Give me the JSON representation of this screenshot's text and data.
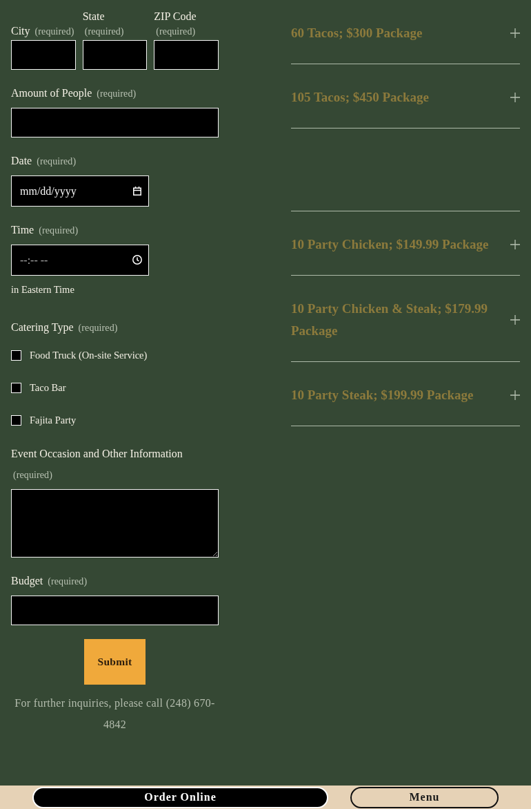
{
  "form": {
    "address_row": [
      {
        "kind": "text",
        "label": "City",
        "required_note": "(required)"
      },
      {
        "kind": "text",
        "label": "State",
        "required_note": "(required)"
      },
      {
        "kind": "text",
        "label": "ZIP Code",
        "required_note": "(required)"
      }
    ],
    "fields": [
      {
        "kind": "text",
        "label": "Amount of People",
        "required_note": "(required)"
      },
      {
        "kind": "date",
        "label": "Date",
        "required_note": "(required)",
        "placeholder": "mm/dd/yyyy"
      },
      {
        "kind": "time",
        "label": "Time",
        "required_note": "(required)",
        "placeholder": "--:-- --",
        "hint": "in Eastern Time"
      },
      {
        "kind": "checkboxes",
        "label": "Catering Type",
        "required_note": "(required)",
        "options": [
          {
            "label": "Food Truck (On-site Service)",
            "checked": false
          },
          {
            "label": "Taco Bar",
            "checked": false
          },
          {
            "label": "Fajita Party",
            "checked": false
          }
        ]
      },
      {
        "kind": "textarea",
        "label": "Event Occasion and Other Information",
        "required_note": "(required)"
      },
      {
        "kind": "text",
        "label": "Budget",
        "required_note": "(required)"
      }
    ],
    "submit_button": {
      "label": "Submit"
    },
    "inquiry_note": "For further inquiries, please call (248) 670-4842"
  },
  "packages": [
    {
      "title": "60 Tacos; $300 Package",
      "expanded": false
    },
    {
      "title": "105 Tacos; $450 Package",
      "expanded": false
    },
    {
      "title": "10 Party Chicken; $149.99 Package",
      "expanded": false
    },
    {
      "title": "10 Party Chicken & Steak; $179.99 Package",
      "expanded": false
    },
    {
      "title": "10 Party Steak; $199.99 Package",
      "expanded": false
    }
  ],
  "bottom_bar": {
    "buttons": [
      {
        "label": "Order Online",
        "kind": "filled"
      },
      {
        "label": "Menu",
        "kind": "outline"
      }
    ]
  }
}
